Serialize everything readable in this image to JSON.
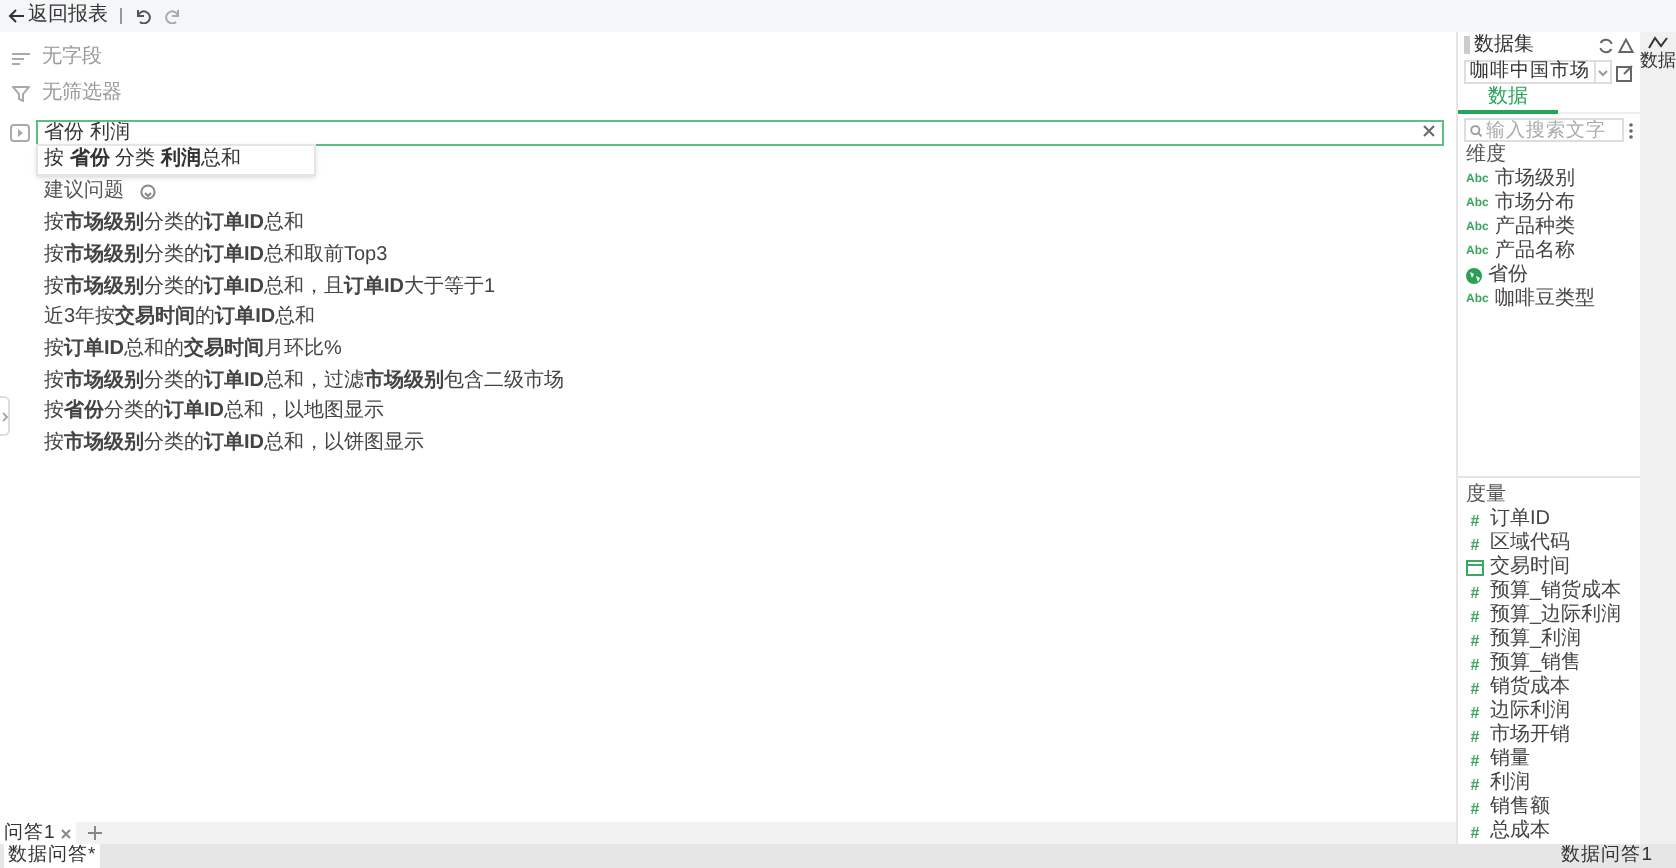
{
  "toolbar": {
    "back": "返回报表"
  },
  "fields": {
    "placeholder": "无字段"
  },
  "filters": {
    "placeholder": "无筛选器"
  },
  "query": {
    "value": "省份 利润"
  },
  "autocomplete": [
    "按 **省份** 分类 **利润**总和"
  ],
  "suggestions": {
    "title": "建议问题",
    "items": [
      "按**市场级别**分类的**订单ID**总和",
      "按**市场级别**分类的**订单ID**总和取前Top3",
      "按**市场级别**分类的**订单ID**总和，且**订单ID**大于等于1",
      "近3年按**交易时间**的**订单ID**总和",
      "按**订单ID**总和的**交易时间**月环比%",
      "按**市场级别**分类的**订单ID**总和，过滤**市场级别**包含二级市场",
      "按**省份**分类的**订单ID**总和，以地图显示",
      "按**市场级别**分类的**订单ID**总和，以饼图显示"
    ]
  },
  "question_tabs": [
    {
      "label": "问答1",
      "selected": true
    }
  ],
  "status_bar": {
    "left": "数据问答*",
    "right": "数据问答1"
  },
  "dataset_panel": {
    "title": "数据集",
    "dataset": "咖啡中国市场",
    "tabs": [
      {
        "label": "数据",
        "selected": true
      }
    ],
    "search": {
      "placeholder": "输入搜索文字"
    },
    "dimensions": {
      "title": "维度",
      "items": [
        {
          "label": "市场级别",
          "kind": "text",
          "badge": "Abc"
        },
        {
          "label": "市场分布",
          "kind": "text",
          "badge": "Abc"
        },
        {
          "label": "产品种类",
          "kind": "text",
          "badge": "Abc"
        },
        {
          "label": "产品名称",
          "kind": "text",
          "badge": "Abc"
        },
        {
          "label": "省份",
          "kind": "geo"
        },
        {
          "label": "咖啡豆类型",
          "kind": "text",
          "badge": "Abc"
        }
      ]
    },
    "measures": {
      "title": "度量",
      "items": [
        {
          "label": "订单ID",
          "kind": "number",
          "badge": "#"
        },
        {
          "label": "区域代码",
          "kind": "number",
          "badge": "#"
        },
        {
          "label": "交易时间",
          "kind": "date"
        },
        {
          "label": "预算_销货成本",
          "kind": "number",
          "badge": "#"
        },
        {
          "label": "预算_边际利润",
          "kind": "number",
          "badge": "#"
        },
        {
          "label": "预算_利润",
          "kind": "number",
          "badge": "#"
        },
        {
          "label": "预算_销售",
          "kind": "number",
          "badge": "#"
        },
        {
          "label": "销货成本",
          "kind": "number",
          "badge": "#"
        },
        {
          "label": "边际利润",
          "kind": "number",
          "badge": "#"
        },
        {
          "label": "市场开销",
          "kind": "number",
          "badge": "#"
        },
        {
          "label": "销量",
          "kind": "number",
          "badge": "#"
        },
        {
          "label": "利润",
          "kind": "number",
          "badge": "#"
        },
        {
          "label": "销售额",
          "kind": "number",
          "badge": "#"
        },
        {
          "label": "总成本",
          "kind": "number",
          "badge": "#"
        }
      ]
    }
  },
  "side_strip": {
    "label": "数据"
  }
}
